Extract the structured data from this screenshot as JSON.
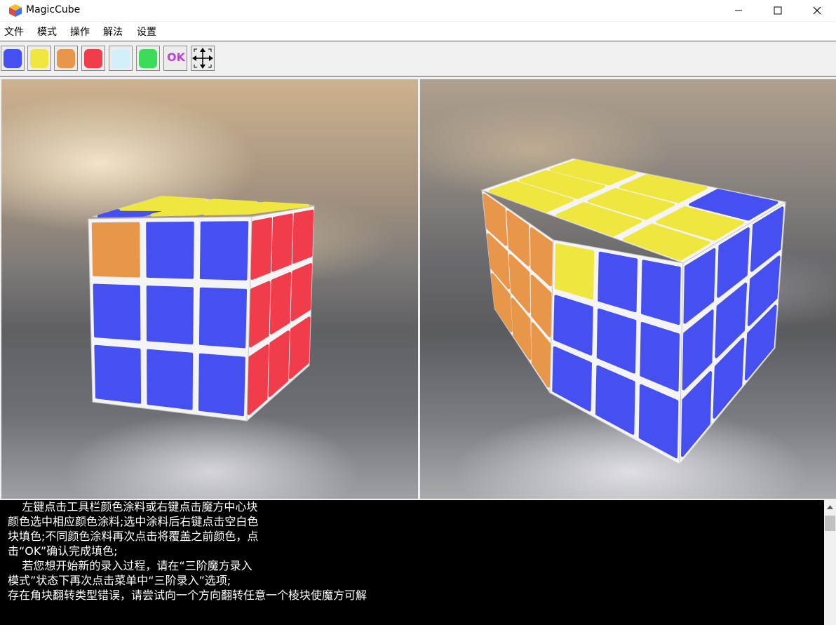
{
  "window": {
    "title": "MagicCube"
  },
  "menu": [
    "文件",
    "模式",
    "操作",
    "解法",
    "设置"
  ],
  "toolbar": {
    "swatches": [
      {
        "name": "blue",
        "color": "#4650f0"
      },
      {
        "name": "yellow",
        "color": "#f0e640"
      },
      {
        "name": "orange",
        "color": "#e8964a"
      },
      {
        "name": "red",
        "color": "#f03c4b"
      },
      {
        "name": "white",
        "color": "#d2f0fa"
      },
      {
        "name": "green",
        "color": "#3cdc5a"
      }
    ],
    "ok_label": "OK",
    "move_icon": "move-arrows-icon"
  },
  "cube_colors": {
    "blue": "#4650f0",
    "yellow": "#f0e640",
    "orange": "#e8964a",
    "red": "#f03c4b",
    "frame": "#f4f4f4"
  },
  "cubes": {
    "left": {
      "top": [
        "blue",
        "yellow",
        "yellow",
        "yellow",
        "yellow",
        "yellow",
        "yellow",
        "yellow",
        "yellow"
      ],
      "front": [
        "orange",
        "blue",
        "blue",
        "blue",
        "blue",
        "blue",
        "blue",
        "blue",
        "blue"
      ],
      "side": [
        "red",
        "red",
        "red",
        "red",
        "red",
        "red",
        "red",
        "red",
        "red"
      ]
    },
    "right": {
      "top": [
        "yellow",
        "yellow",
        "yellow",
        "yellow",
        "yellow",
        "yellow",
        "yellow",
        "yellow",
        "blue"
      ],
      "front": [
        "yellow",
        "blue",
        "blue",
        "blue",
        "blue",
        "blue",
        "blue",
        "blue",
        "blue"
      ],
      "side": [
        "orange",
        "orange",
        "orange",
        "orange",
        "orange",
        "orange",
        "orange",
        "orange",
        "orange"
      ]
    }
  },
  "console": {
    "lines": [
      "    左键点击工具栏颜色涂料或右键点击魔方中心块",
      "颜色选中相应颜色涂料;选中涂料后右键点击空白色",
      "块填色;不同颜色涂料再次点击将覆盖之前颜色，点",
      "击“OK”确认完成填色;",
      "    若您想开始新的录入过程，请在“三阶魔方录入",
      "模式”状态下再次点击菜单中“三阶录入”选项;",
      "存在角块翻转类型错误，请尝试向一个方向翻转任意一个棱块使魔方可解"
    ]
  }
}
